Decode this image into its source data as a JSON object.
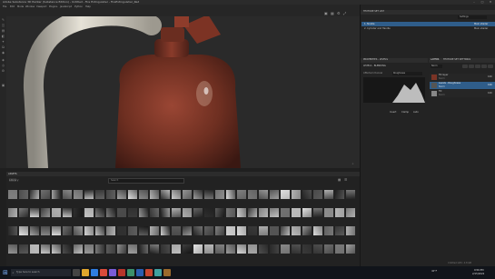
{
  "window": {
    "title": "Adobe Substance 3D Painter (Substance Edition) - Untitled - Fire Extinguisher - FireExtinguisher_Red",
    "controls": [
      "–",
      "□",
      "✕"
    ]
  },
  "menu": [
    "File",
    "Edit",
    "Mode",
    "Window",
    "Viewport",
    "Plugins",
    "JavaScript",
    "Python",
    "Help"
  ],
  "viewport": {
    "mode_select": "Material",
    "icons": [
      "camera-icon",
      "grid-icon",
      "settings-icon",
      "maximize-icon"
    ]
  },
  "texture_set_list": {
    "title": "TEXTURE SET LIST",
    "items": [
      {
        "label": "1. Nozzle",
        "shader": "Main shader"
      },
      {
        "label": "2. Cylinder and Handle",
        "shader": "Main shader"
      }
    ],
    "settings": "Settings"
  },
  "properties": {
    "title": "PROPERTIES - LEVELS",
    "section": "LEVELS - BLENDING",
    "affected_channel": "Affected channel",
    "channel_value": "Roughness",
    "buttons": [
      "Invert",
      "Clamp",
      "Auto"
    ]
  },
  "layers": {
    "tabs": [
      "LAYERS",
      "TEXTURE SET SETTINGS"
    ],
    "blend": "Norm",
    "items": [
      {
        "name": "Fill layer",
        "sub": "Norm",
        "value": "100"
      },
      {
        "name": "Levels - Roughness",
        "sub": "Norm",
        "value": "100"
      },
      {
        "name": "Fill",
        "sub": "Norm",
        "value": "100"
      }
    ]
  },
  "assets": {
    "title": "ASSETS",
    "search_placeholder": "Search",
    "filter": "Library"
  },
  "taskbar": {
    "search": "Type here to search",
    "weather": "40°F",
    "time": "9:56 PM",
    "date": "2/15/2022"
  },
  "status": "Untitled GPU: 4.8 GB",
  "colors": {
    "extinguisher": "#7a3626",
    "handle": "#d8d4c8",
    "viewport_bg": "#2a2a2a",
    "selection": "#2f5d8a"
  }
}
